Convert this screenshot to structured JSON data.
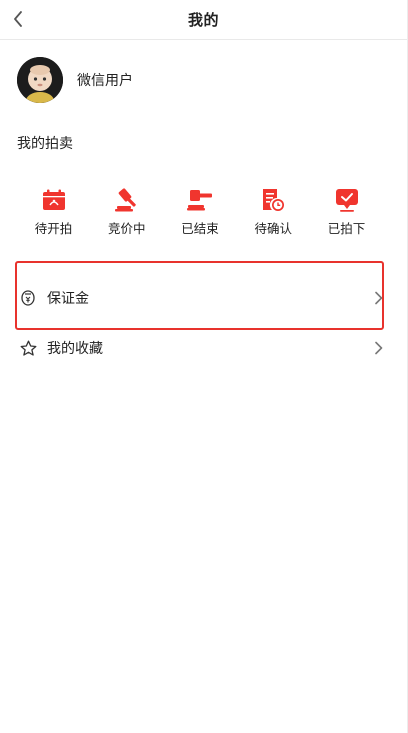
{
  "header": {
    "title": "我的"
  },
  "profile": {
    "username": "微信用户"
  },
  "auction_section": {
    "label": "我的拍卖",
    "items": [
      {
        "label": "待开拍",
        "icon": "calendar-icon"
      },
      {
        "label": "竞价中",
        "icon": "gavel-icon"
      },
      {
        "label": "已结束",
        "icon": "hammer-icon"
      },
      {
        "label": "待确认",
        "icon": "document-clock-icon"
      },
      {
        "label": "已拍下",
        "icon": "check-chat-icon"
      }
    ]
  },
  "menu": {
    "items": [
      {
        "label": "保证金",
        "icon": "deposit-coin-icon"
      },
      {
        "label": "我的收藏",
        "icon": "star-icon"
      }
    ]
  },
  "colors": {
    "accent": "#f0352e",
    "highlight_border": "#e8332d"
  }
}
